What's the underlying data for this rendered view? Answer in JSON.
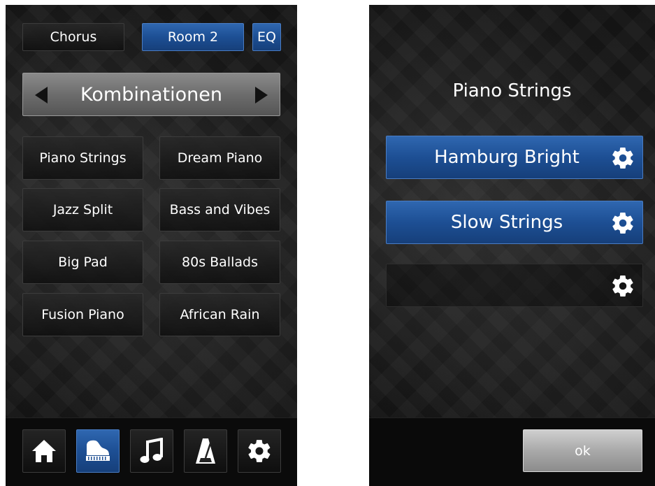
{
  "left": {
    "top_buttons": {
      "chorus": "Chorus",
      "room": "Room 2",
      "eq": "EQ"
    },
    "banner_title": "Kombinationen",
    "presets": [
      "Piano Strings",
      "Dream Piano",
      "Jazz Split",
      "Bass and Vibes",
      "Big Pad",
      "80s Ballads",
      "Fusion Piano",
      "African Rain"
    ],
    "nav": [
      {
        "icon": "home-icon",
        "active": false
      },
      {
        "icon": "piano-icon",
        "active": true
      },
      {
        "icon": "music-note-icon",
        "active": false
      },
      {
        "icon": "metronome-icon",
        "active": false
      },
      {
        "icon": "gear-icon",
        "active": false
      }
    ]
  },
  "right": {
    "title": "Piano Strings",
    "slots": [
      {
        "label": "Hamburg Bright",
        "filled": true
      },
      {
        "label": "Slow Strings",
        "filled": true
      },
      {
        "label": "",
        "filled": false
      }
    ],
    "ok_label": "ok"
  },
  "colors": {
    "accent_blue": "#1d4f94",
    "background": "#1a1a1a",
    "ok_gray": "#a9a9a9"
  }
}
